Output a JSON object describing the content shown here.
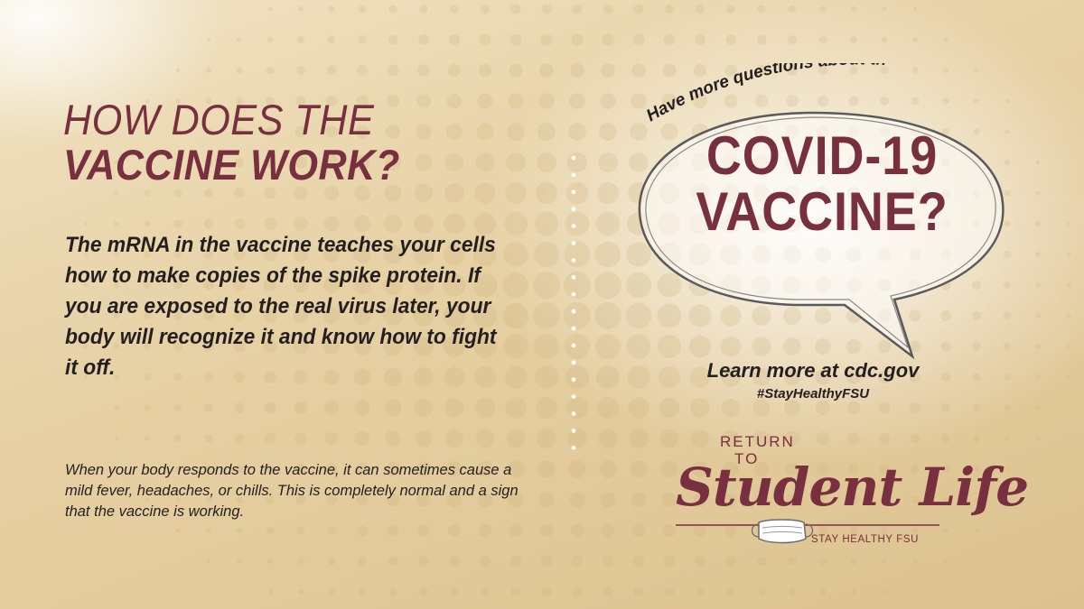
{
  "left": {
    "heading_line1": "HOW DOES THE",
    "heading_line2": "VACCINE WORK?",
    "body": "The mRNA in the vaccine teaches your cells how to make copies of the spike protein. If you are exposed to the real virus later, your body will recognize it and know how to fight it off.",
    "note": "When your body responds to the vaccine, it can sometimes cause a mild fever, headaches, or chills. This is completely normal and a sign that the vaccine is working."
  },
  "bubble": {
    "prompt": "Have more questions about the",
    "title_line1": "COVID-19",
    "title_line2": "VACCINE?"
  },
  "learn_more": "Learn more at cdc.gov",
  "hashtag": "#StayHealthyFSU",
  "logo": {
    "return": "RETURN",
    "to": "TO",
    "main": "Student Life",
    "tagline": "STAY HEALTHY FSU"
  },
  "colors": {
    "garnet": "#782f40",
    "text": "#231f20",
    "gold": "#e6d0a3"
  },
  "icons": [
    "face-mask-icon",
    "speech-bubble-icon"
  ]
}
